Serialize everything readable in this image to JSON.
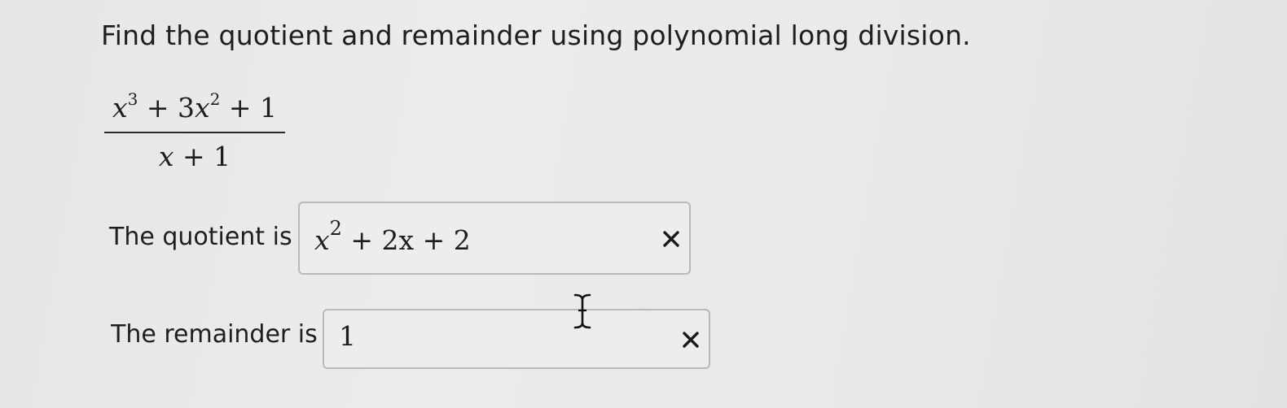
{
  "instruction": "Find the quotient and remainder using polynomial long division.",
  "expression": {
    "numerator": {
      "t1_var": "x",
      "t1_exp": "3",
      "op1": "+",
      "t2_coef": "3",
      "t2_var": "x",
      "t2_exp": "2",
      "op2": "+",
      "t3": "1"
    },
    "denominator": {
      "t1_var": "x",
      "op1": "+",
      "t2": "1"
    }
  },
  "quotient": {
    "label": "The quotient is",
    "value": {
      "var": "x",
      "exp": "2",
      "rest": " + 2x + 2"
    },
    "status_icon": "x-mark-icon",
    "status_color": "#1a1a1a"
  },
  "remainder": {
    "label": "The remainder is",
    "value": "1",
    "status_icon": "x-mark-icon",
    "status_color": "#1a1a1a"
  },
  "cursor": "text-cursor-icon"
}
